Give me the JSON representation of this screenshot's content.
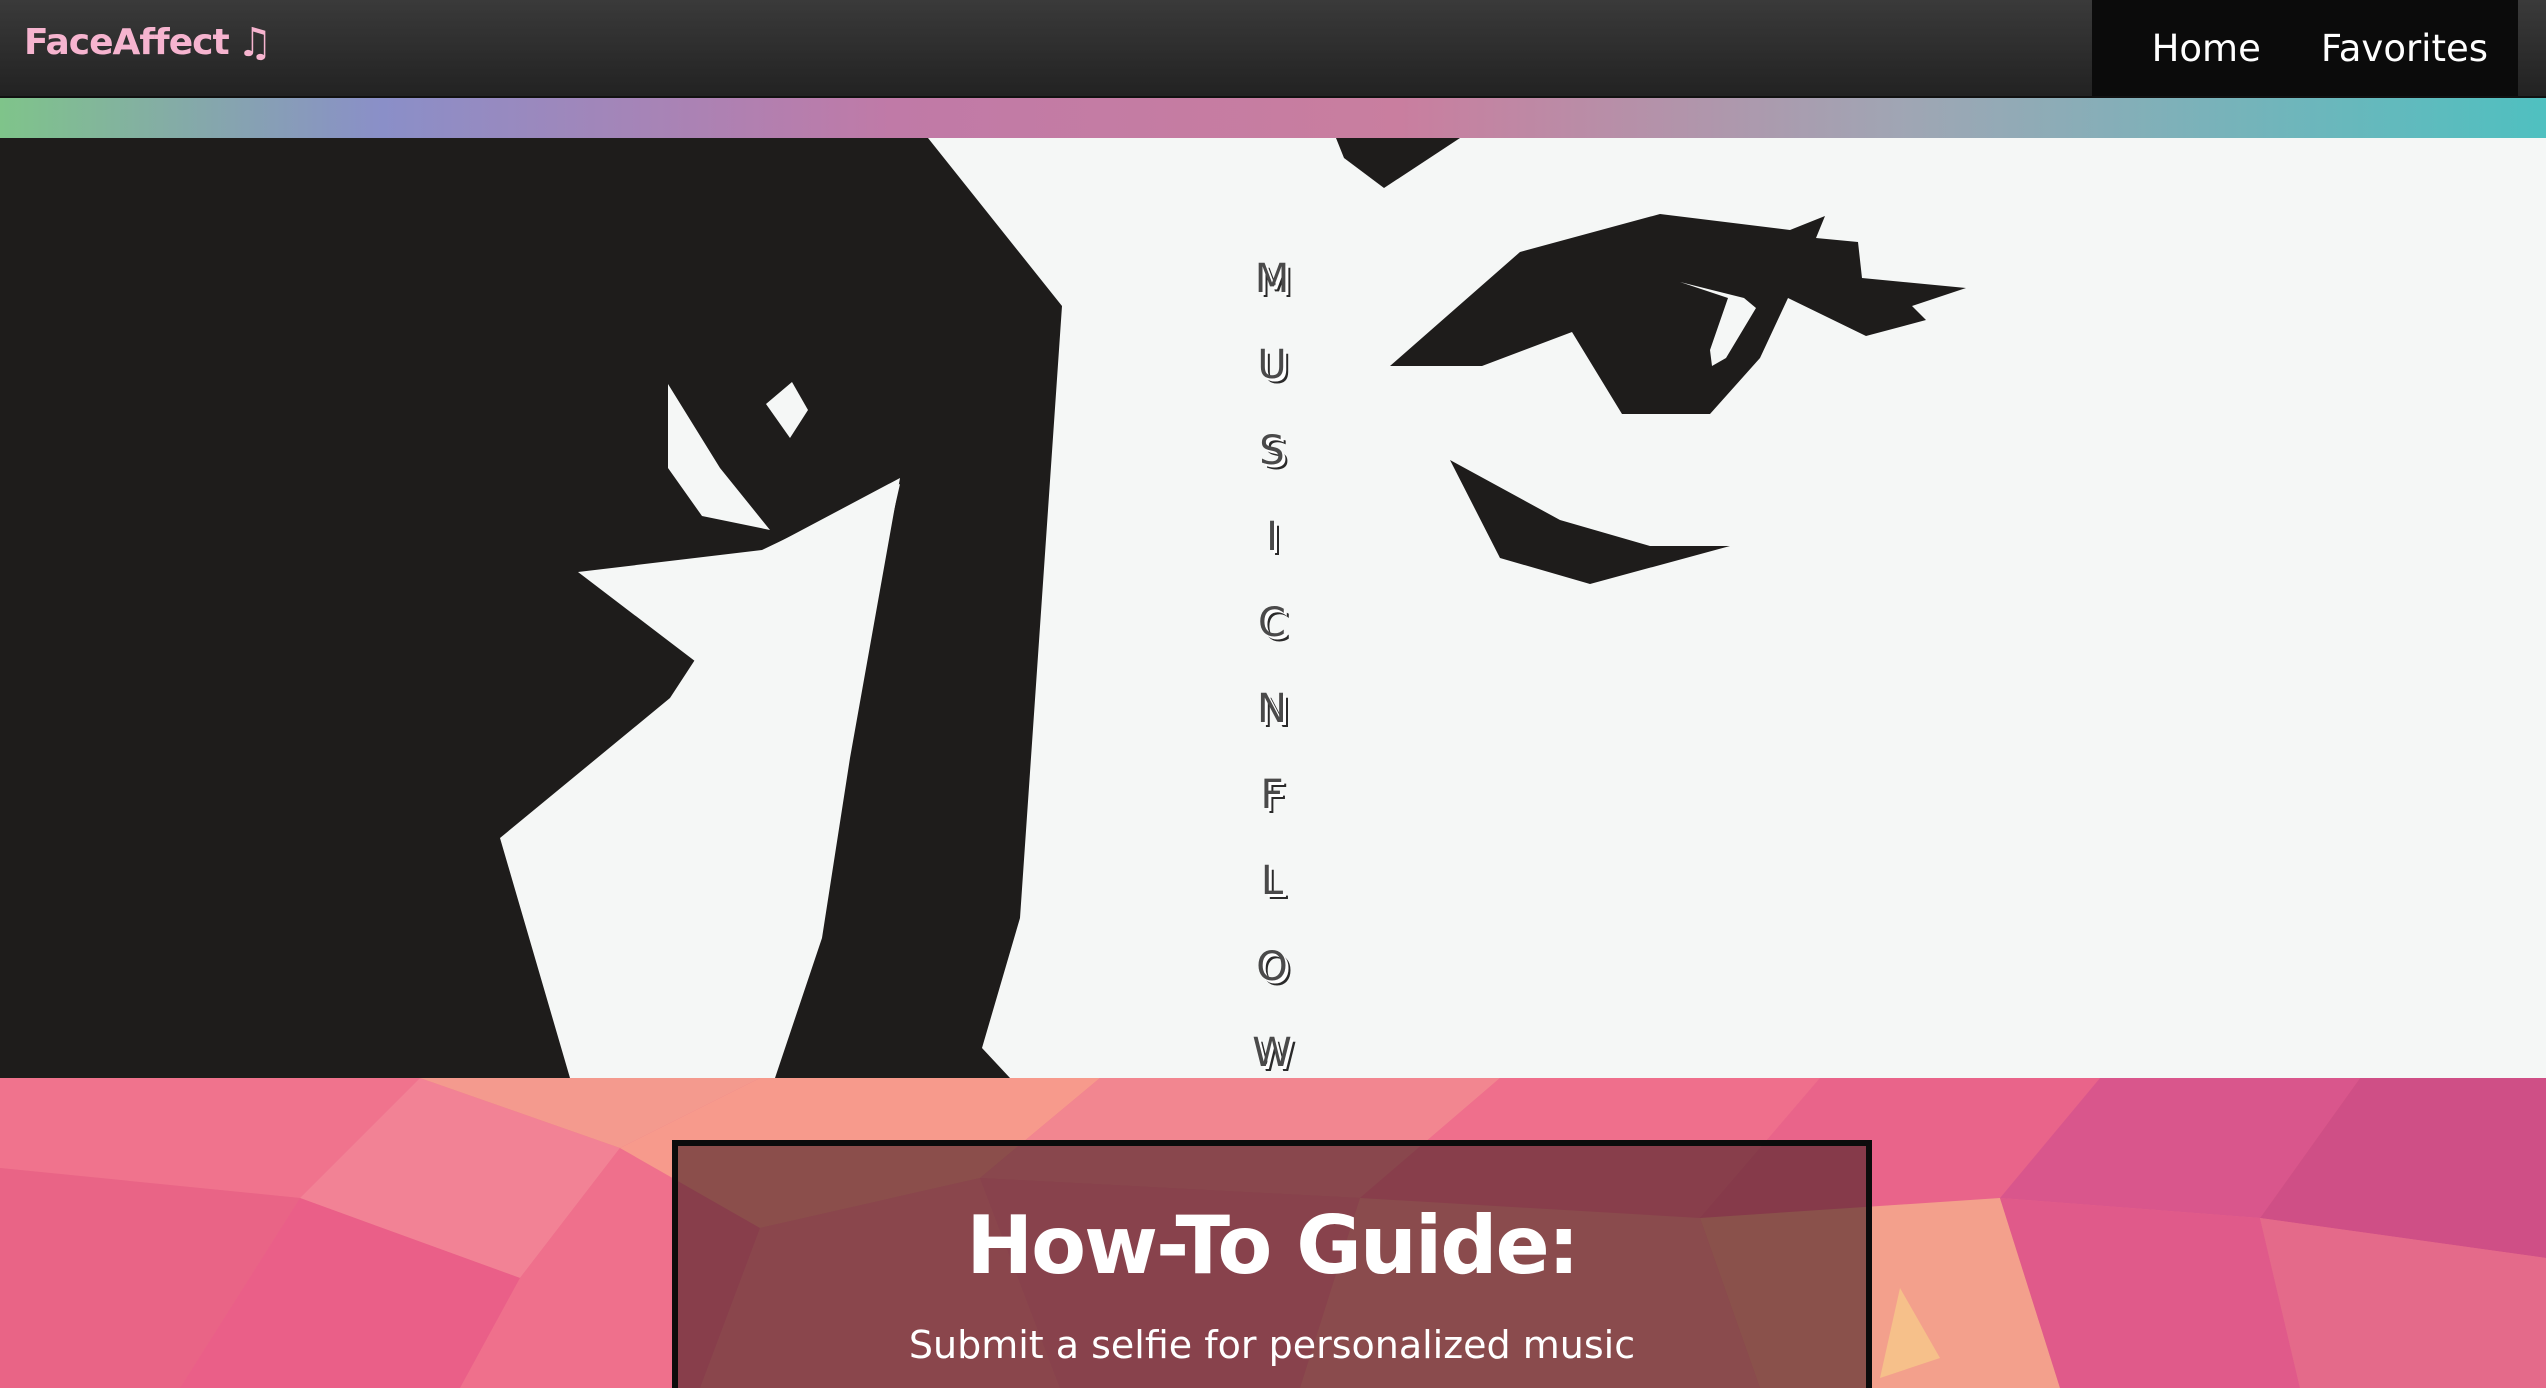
{
  "navbar": {
    "brand": "FaceAffect",
    "brand_icon": "music-note-icon",
    "brand_icon_glyph": "♫",
    "brand_color": "#f6b4cf",
    "links": [
      {
        "label": "Home"
      },
      {
        "label": "Favorites"
      }
    ]
  },
  "hero": {
    "vertical_letters": [
      "M",
      "U",
      "S",
      "I",
      "C",
      "N",
      "F",
      "L",
      "O",
      "W"
    ]
  },
  "guide": {
    "title": "How-To Guide:",
    "text": "Submit a selfie for personalized music selections based on your mood."
  },
  "colors": {
    "navbar_bg": "#2b2b2b",
    "nav_links_bg": "#0b0b0b",
    "hero_dark": "#1e1c1b",
    "hero_light": "#f5f7f6",
    "poly_pink": "#ea6c8a",
    "card_border": "#0c0c0c"
  }
}
